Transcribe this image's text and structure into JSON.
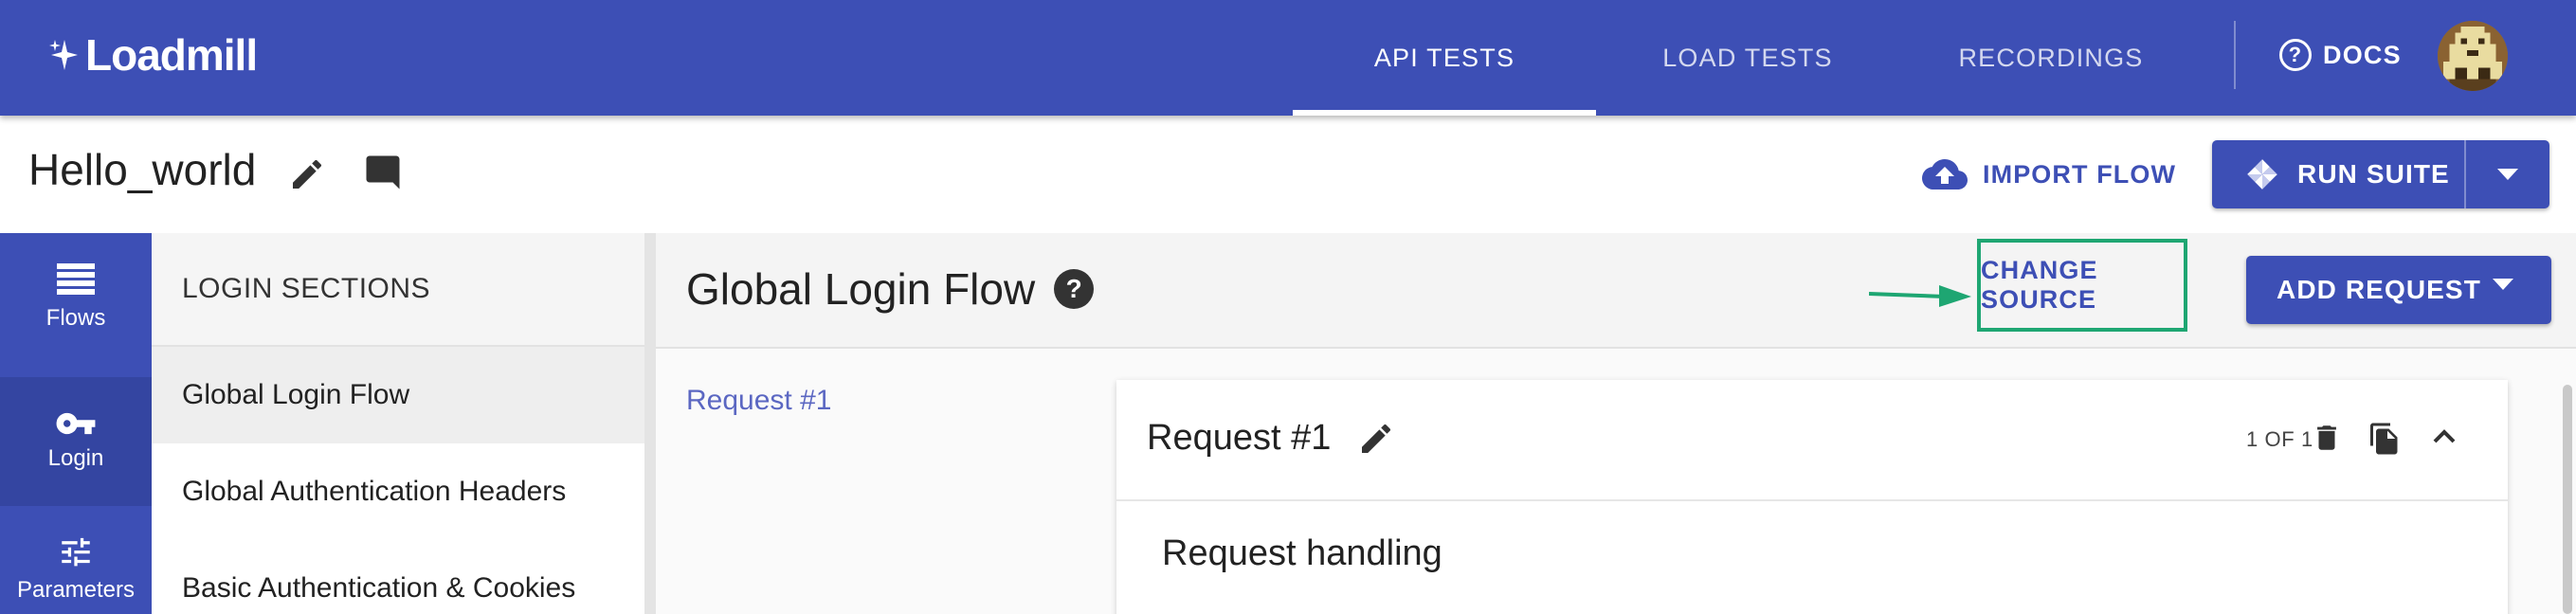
{
  "app": {
    "brand": "Loadmill"
  },
  "nav": {
    "tabs": [
      {
        "label": "API TESTS",
        "active": true
      },
      {
        "label": "LOAD TESTS",
        "active": false
      },
      {
        "label": "RECORDINGS",
        "active": false
      }
    ],
    "docs_label": "DOCS"
  },
  "suite": {
    "title": "Hello_world",
    "import_flow_label": "IMPORT FLOW",
    "run_suite_label": "RUN SUITE"
  },
  "rail": {
    "items": [
      {
        "label": "Flows",
        "icon": "list-icon"
      },
      {
        "label": "Login",
        "icon": "key-icon",
        "active": true
      },
      {
        "label": "Parameters",
        "icon": "sliders-icon"
      }
    ]
  },
  "sections": {
    "header": "LOGIN SECTIONS",
    "items": [
      {
        "label": "Global Login Flow",
        "selected": true
      },
      {
        "label": "Global Authentication Headers"
      },
      {
        "label": "Basic Authentication & Cookies"
      }
    ]
  },
  "main": {
    "flow_title": "Global Login Flow",
    "change_source_label": "CHANGE SOURCE",
    "add_request_label": "ADD REQUEST",
    "request_link": "Request #1",
    "request_card": {
      "title": "Request #1",
      "count": "1 OF 1",
      "body_title": "Request handling"
    }
  },
  "colors": {
    "primary": "#3d4fb5",
    "annotation": "#1ea672"
  }
}
